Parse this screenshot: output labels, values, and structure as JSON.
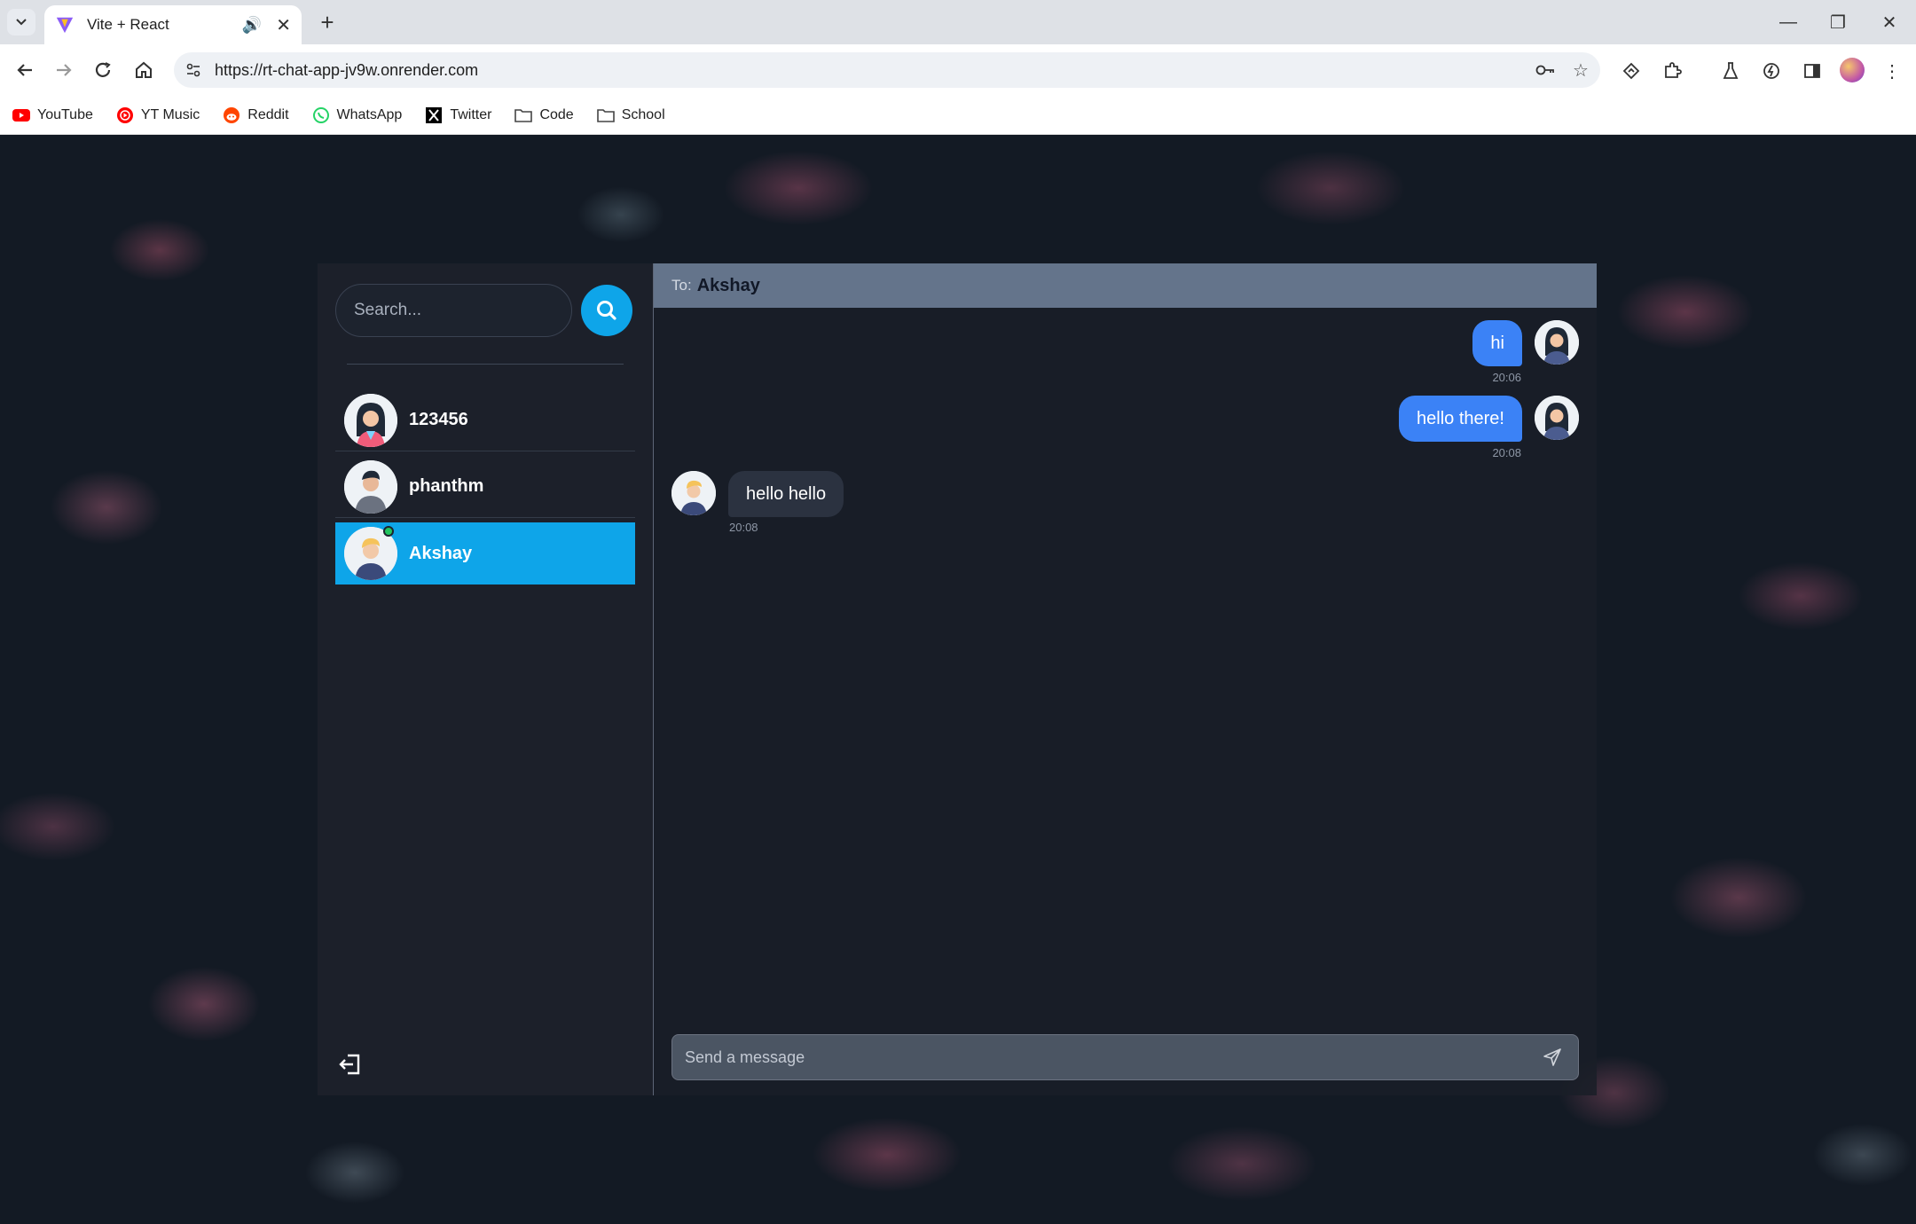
{
  "browser": {
    "tab_title": "Vite + React",
    "url": "https://rt-chat-app-jv9w.onrender.com",
    "bookmarks": [
      {
        "label": "YouTube",
        "icon": "youtube-icon"
      },
      {
        "label": "YT Music",
        "icon": "yt-music-icon"
      },
      {
        "label": "Reddit",
        "icon": "reddit-icon"
      },
      {
        "label": "WhatsApp",
        "icon": "whatsapp-icon"
      },
      {
        "label": "Twitter",
        "icon": "x-twitter-icon"
      },
      {
        "label": "Code",
        "icon": "folder-icon"
      },
      {
        "label": "School",
        "icon": "folder-icon"
      }
    ]
  },
  "sidebar": {
    "search_placeholder": "Search...",
    "conversations": [
      {
        "name": "123456",
        "online": false,
        "selected": false
      },
      {
        "name": "phanthm",
        "online": false,
        "selected": false
      },
      {
        "name": "Akshay",
        "online": true,
        "selected": true
      }
    ]
  },
  "chat": {
    "to_label": "To:",
    "to_name": "Akshay",
    "messages": [
      {
        "text": "hi",
        "time": "20:06",
        "from_me": true
      },
      {
        "text": "hello there!",
        "time": "20:08",
        "from_me": true
      },
      {
        "text": "hello hello",
        "time": "20:08",
        "from_me": false
      }
    ],
    "composer_placeholder": "Send a message"
  },
  "colors": {
    "accent": "#0ea5e9",
    "my_bubble": "#3b82f6",
    "header": "#64748b",
    "online": "#22c55e"
  }
}
